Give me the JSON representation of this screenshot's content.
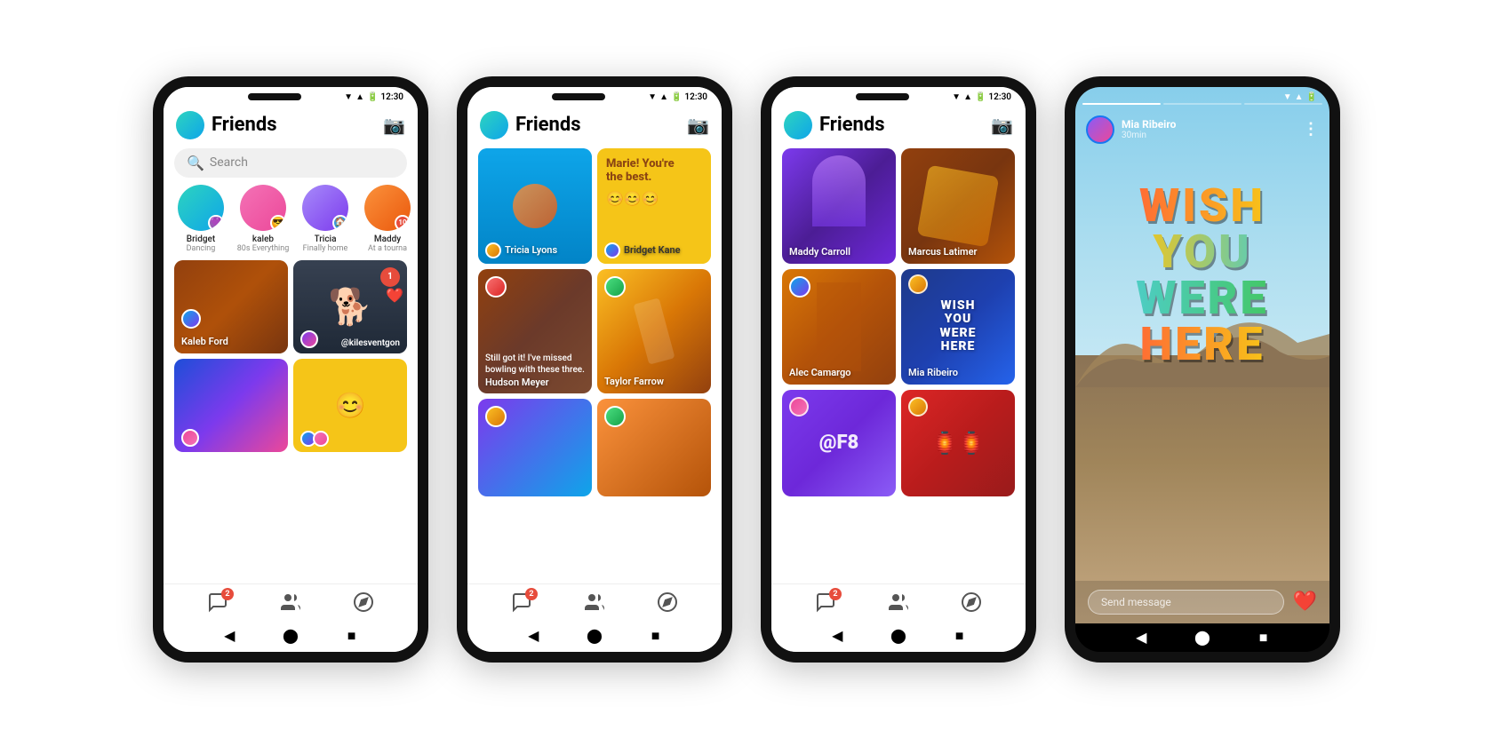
{
  "phone1": {
    "status_time": "12:30",
    "title": "Friends",
    "search_placeholder": "Search",
    "stories": [
      {
        "name": "Bridget",
        "status": "Dancing",
        "color": "av-teal"
      },
      {
        "name": "kaleb",
        "status": "80s Everything",
        "color": "av-pink"
      },
      {
        "name": "Tricia",
        "status": "Finally home",
        "color": "av-purple"
      },
      {
        "name": "Maddy",
        "status": "At a tourna",
        "color": "av-orange"
      }
    ],
    "cells": [
      {
        "label": "Kaleb Ford",
        "color": "cell-brown"
      },
      {
        "label": "@kilesventgon",
        "color": "cell-dark"
      },
      {
        "label": "",
        "color": "cell-blue2"
      },
      {
        "label": "",
        "color": "cell-yellow2"
      }
    ],
    "nav_badge": "2"
  },
  "phone2": {
    "status_time": "12:30",
    "title": "Friends",
    "cells": [
      {
        "label": "Tricia Lyons",
        "color": "cell-sky",
        "top_label": ""
      },
      {
        "label": "Bridget Kane",
        "color": "cell-gold",
        "top_label": "Marie! You're the best."
      },
      {
        "label": "Still got it! I've missed bowling with these three.\nHudson Meyer",
        "color": "cell-corridor"
      },
      {
        "label": "Taylor Farrow",
        "color": "cell-golfer"
      },
      {
        "label": "",
        "color": "cell-grey"
      },
      {
        "label": "",
        "color": "cell-amber"
      }
    ],
    "nav_badge": "2"
  },
  "phone3": {
    "status_time": "12:30",
    "title": "Friends",
    "cells": [
      {
        "label": "Maddy Carroll",
        "color": "cell-hair"
      },
      {
        "label": "Marcus Latimer",
        "color": "cell-rust"
      },
      {
        "label": "Alec Camargo",
        "color": "cell-fashion"
      },
      {
        "label": "Mia Ribeiro",
        "color": "cell-wishcard"
      },
      {
        "label": "@F8",
        "color": "cell-violet"
      },
      {
        "label": "",
        "color": "cell-redlamp"
      }
    ],
    "nav_badge": "2",
    "wish_text": "WISH\nYOU\nWERE\nHERE"
  },
  "phone4": {
    "user_name": "Mia Ribeiro",
    "time_ago": "30min",
    "send_placeholder": "Send message",
    "wish_text": "WISH\nYOU\nWERE\nHERE"
  }
}
